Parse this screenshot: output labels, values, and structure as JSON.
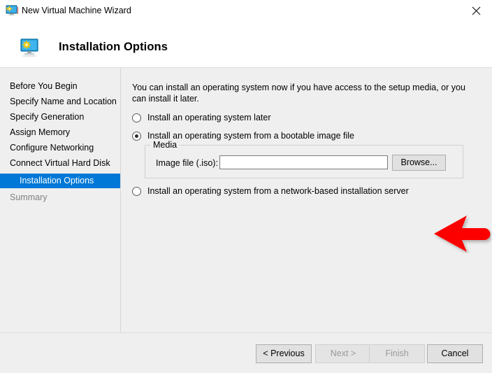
{
  "window": {
    "title": "New Virtual Machine Wizard",
    "title_icon": "virtual-machine-monitor-icon",
    "close_label": "✕"
  },
  "header": {
    "icon": "virtual-machine-monitor-icon",
    "title": "Installation Options"
  },
  "sidebar": {
    "items": [
      {
        "label": "Before You Begin",
        "state": "normal"
      },
      {
        "label": "Specify Name and Location",
        "state": "normal"
      },
      {
        "label": "Specify Generation",
        "state": "normal"
      },
      {
        "label": "Assign Memory",
        "state": "normal"
      },
      {
        "label": "Configure Networking",
        "state": "normal"
      },
      {
        "label": "Connect Virtual Hard Disk",
        "state": "normal"
      },
      {
        "label": "Installation Options",
        "state": "selected"
      },
      {
        "label": "Summary",
        "state": "disabled"
      }
    ],
    "selected_color": "#0078d7"
  },
  "main": {
    "intro": "You can install an operating system now if you have access to the setup media, or you can install it later.",
    "options": [
      {
        "label": "Install an operating system later",
        "checked": false
      },
      {
        "label": "Install an operating system from a bootable image file",
        "checked": true
      },
      {
        "label": "Install an operating system from a network-based installation server",
        "checked": false
      }
    ],
    "media_group": {
      "legend": "Media",
      "iso_label": "Image file (.iso):",
      "iso_value": "",
      "iso_placeholder": "",
      "browse_label": "Browse..."
    }
  },
  "footer": {
    "buttons": [
      {
        "label": "< Previous",
        "enabled": true
      },
      {
        "label": "Next >",
        "enabled": false
      },
      {
        "label": "Finish",
        "enabled": false
      },
      {
        "label": "Cancel",
        "enabled": true
      }
    ]
  },
  "annotation": {
    "arrow": "left-pointing-arrow",
    "color": "#fc0000",
    "points_to": "Browse..."
  }
}
